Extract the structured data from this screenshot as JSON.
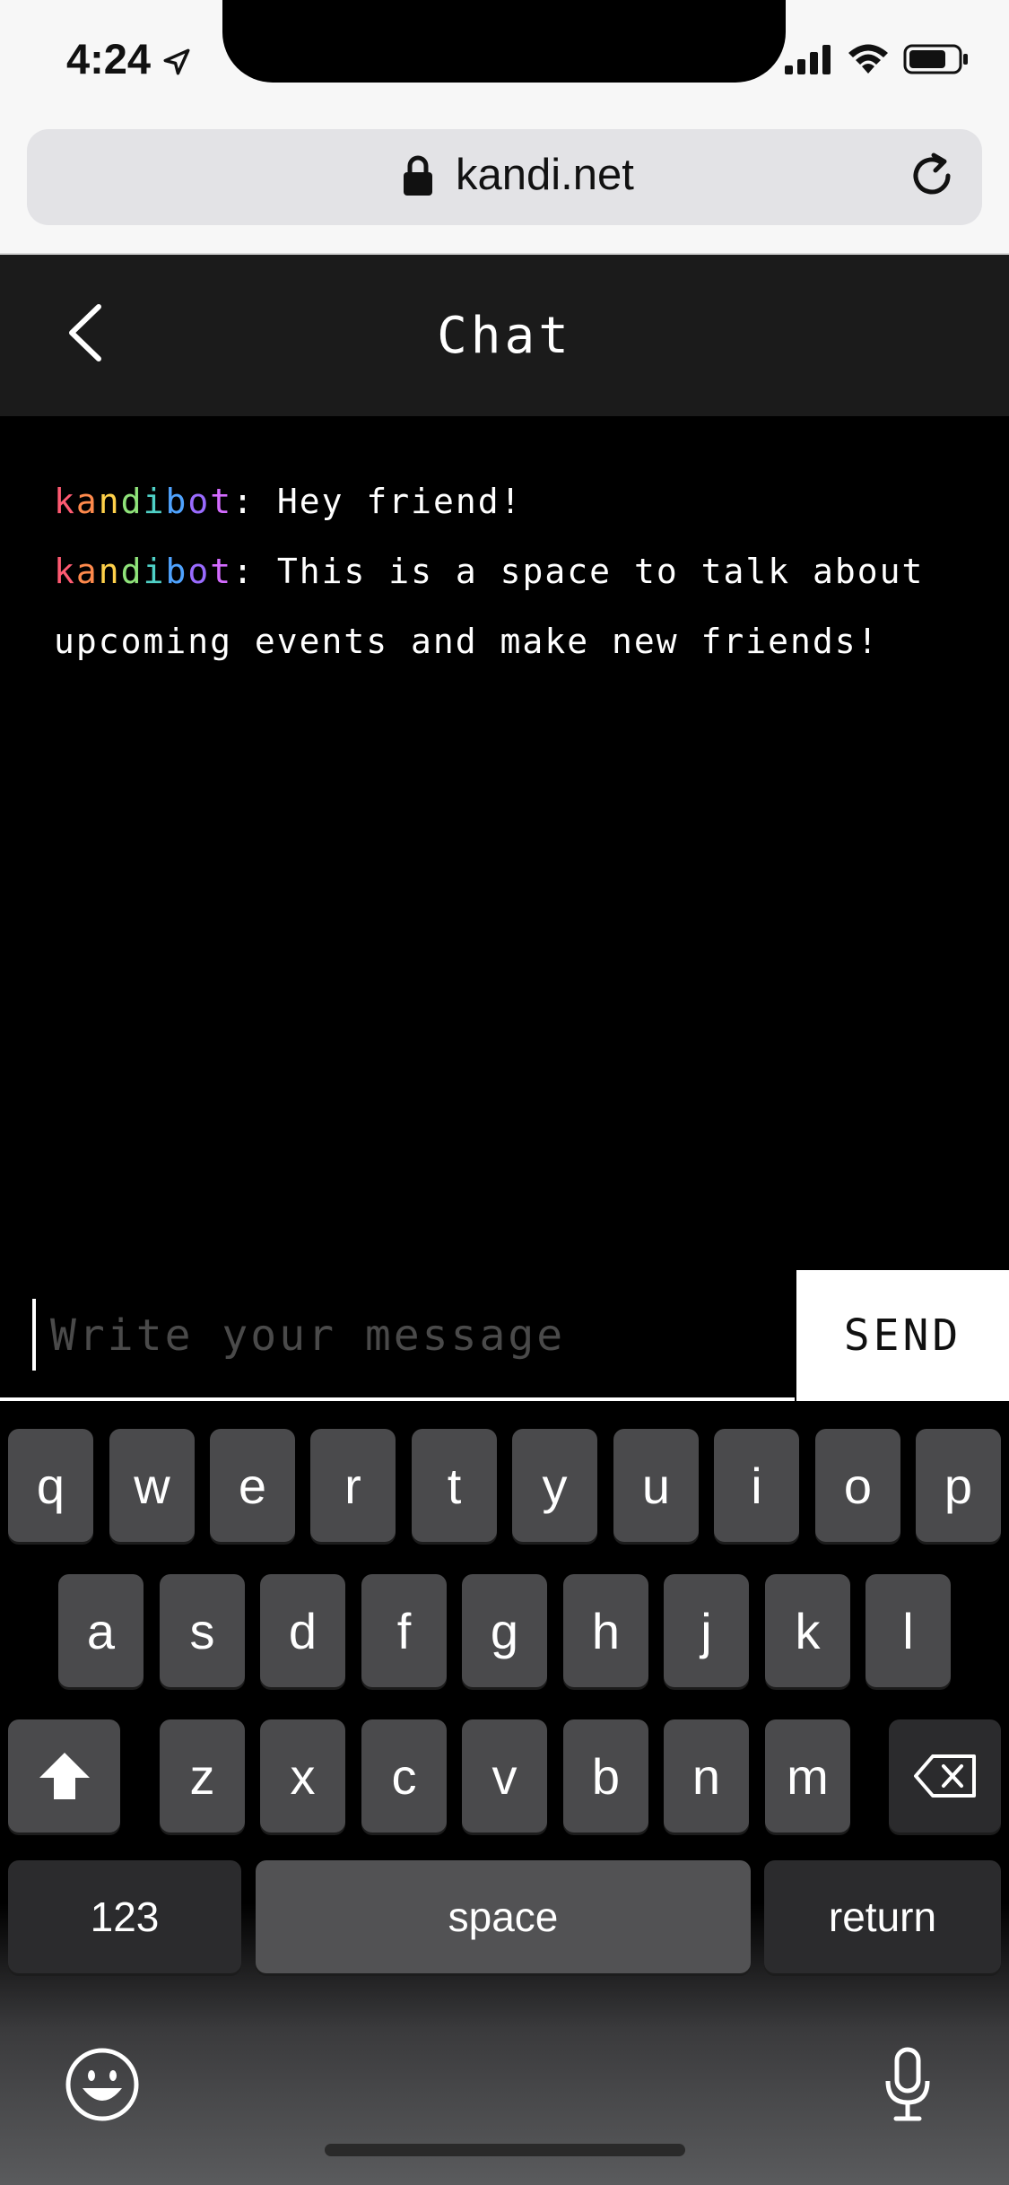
{
  "status_bar": {
    "time": "4:24"
  },
  "browser": {
    "url": "kandi.net"
  },
  "header": {
    "title": "Chat"
  },
  "messages": [
    {
      "user": "kandibot",
      "text": "Hey friend!"
    },
    {
      "user": "kandibot",
      "text": "This is a space to talk about upcoming events and make new friends!"
    }
  ],
  "composer": {
    "placeholder": "Write your message",
    "value": "",
    "send_label": "SEND"
  },
  "keyboard": {
    "row1": [
      "q",
      "w",
      "e",
      "r",
      "t",
      "y",
      "u",
      "i",
      "o",
      "p"
    ],
    "row2": [
      "a",
      "s",
      "d",
      "f",
      "g",
      "h",
      "j",
      "k",
      "l"
    ],
    "row3": [
      "z",
      "x",
      "c",
      "v",
      "b",
      "n",
      "m"
    ],
    "numbers_label": "123",
    "space_label": "space",
    "return_label": "return"
  }
}
